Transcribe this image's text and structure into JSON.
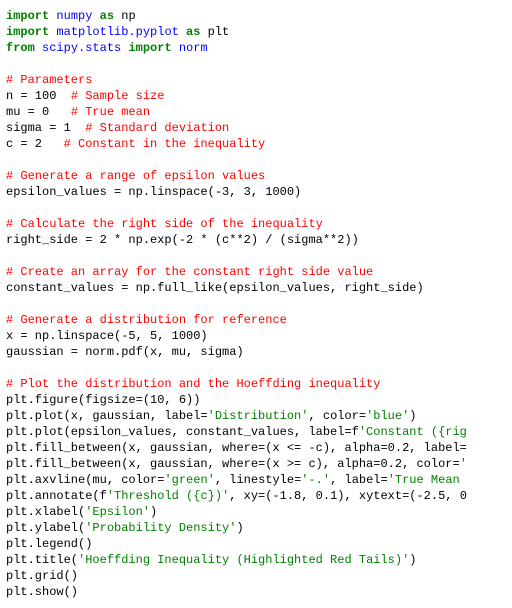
{
  "code": {
    "l1": {
      "kw1": "import",
      "lib": "numpy",
      "kw2": "as",
      "alias": "np"
    },
    "l2": {
      "kw1": "import",
      "lib": "matplotlib.pyplot",
      "kw2": "as",
      "alias": "plt"
    },
    "l3": {
      "kw1": "from",
      "lib": "scipy.stats",
      "kw2": "import",
      "name": "norm"
    },
    "c1": "# Parameters",
    "l5": {
      "text": "n = 100  ",
      "cmt": "# Sample size"
    },
    "l6": {
      "text": "mu = 0   ",
      "cmt": "# True mean"
    },
    "l7": {
      "text": "sigma = 1  ",
      "cmt": "# Standard deviation"
    },
    "l8": {
      "text": "c = 2   ",
      "cmt": "# Constant in the inequality"
    },
    "c2": "# Generate a range of epsilon values",
    "l10": "epsilon_values = np.linspace(-3, 3, 1000)",
    "c3": "# Calculate the right side of the inequality",
    "l12": "right_side = 2 * np.exp(-2 * (c**2) / (sigma**2))",
    "c4": "# Create an array for the constant right side value",
    "l14": "constant_values = np.full_like(epsilon_values, right_side)",
    "c5": "# Generate a distribution for reference",
    "l16": "x = np.linspace(-5, 5, 1000)",
    "l17": "gaussian = norm.pdf(x, mu, sigma)",
    "c6": "# Plot the distribution and the Hoeffding inequality",
    "l19": "plt.figure(figsize=(10, 6))",
    "l20": {
      "a": "plt.plot(x, gaussian, label=",
      "s1": "'Distribution'",
      "b": ", color=",
      "s2": "'blue'",
      "c": ")"
    },
    "l21": {
      "a": "plt.plot(epsilon_values, constant_values, label=f",
      "s1": "'Constant ({rig"
    },
    "l22": {
      "a": "plt.fill_between(x, gaussian, where=(x <= -c), alpha=0.2, label="
    },
    "l23": {
      "a": "plt.fill_between(x, gaussian, where=(x >= c), alpha=0.2, color=",
      "s1": "'"
    },
    "l24": {
      "a": "plt.axvline(mu, color=",
      "s1": "'green'",
      "b": ", linestyle=",
      "s2": "'-.'",
      "c": ", label=",
      "s3": "'True Mean"
    },
    "l25": {
      "a": "plt.annotate(f",
      "s1": "'Threshold ({c})'",
      "b": ", xy=(-1.8, 0.1), xytext=(-2.5, 0"
    },
    "l26": {
      "a": "plt.xlabel(",
      "s1": "'Epsilon'",
      "b": ")"
    },
    "l27": {
      "a": "plt.ylabel(",
      "s1": "'Probability Density'",
      "b": ")"
    },
    "l28": "plt.legend()",
    "l29": {
      "a": "plt.title(",
      "s1": "'Hoeffding Inequality (Highlighted Red Tails)'",
      "b": ")"
    },
    "l30": "plt.grid()",
    "l31": "plt.show()"
  }
}
